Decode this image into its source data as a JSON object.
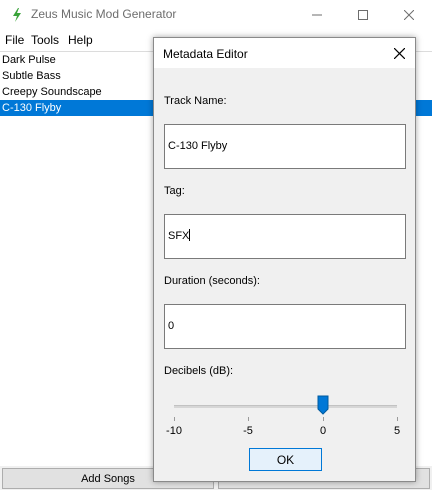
{
  "app": {
    "title": "Zeus Music Mod Generator"
  },
  "menu": {
    "file": "File",
    "tools": "Tools",
    "help": "Help"
  },
  "songs": [
    {
      "label": "Dark Pulse"
    },
    {
      "label": "Subtle Bass"
    },
    {
      "label": "Creepy Soundscape"
    },
    {
      "label": "C-130 Flyby",
      "selected": true
    }
  ],
  "buttons": {
    "add_songs": "Add Songs"
  },
  "dialog": {
    "title": "Metadata Editor",
    "track_name_label": "Track Name:",
    "track_name_value": "C-130 Flyby",
    "tag_label": "Tag:",
    "tag_value": "SFX",
    "duration_label": "Duration (seconds):",
    "duration_value": "0",
    "decibels_label": "Decibels (dB):",
    "decibels_value": 0,
    "decibels_range": [
      -10,
      5
    ],
    "tick_labels": [
      "-10",
      "-5",
      "0",
      "5"
    ],
    "ok_label": "OK"
  },
  "colors": {
    "selection": "#0078d7",
    "icon": "#3aa33a"
  }
}
